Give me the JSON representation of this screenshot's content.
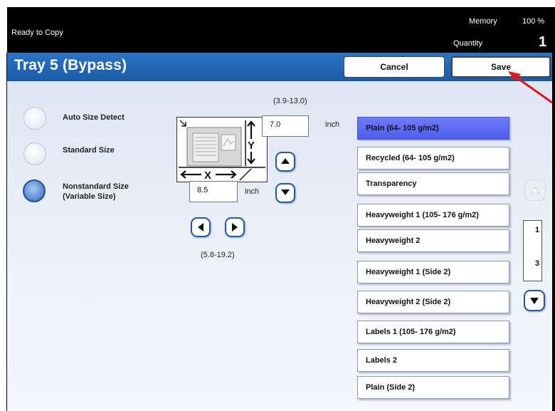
{
  "status": {
    "ready_text": "Ready to Copy",
    "memory_label": "Memory",
    "memory_value": "100 %",
    "quantity_label": "Quantity",
    "quantity_value": "1"
  },
  "header": {
    "title": "Tray 5 (Bypass)",
    "cancel_label": "Cancel",
    "save_label": "Save"
  },
  "size_options": {
    "items": [
      {
        "label": "Auto Size Detect",
        "selected": false
      },
      {
        "label": "Standard Size",
        "selected": false
      },
      {
        "label_line1": "Nonstandard Size",
        "label_line2": "(Variable Size)",
        "selected": true
      }
    ]
  },
  "dimensions": {
    "y_range": "(3.9-13.0)",
    "y_value": "7.0",
    "y_unit": "inch",
    "x_range": "(5.8-19.2)",
    "x_value": "8.5",
    "x_unit": "inch",
    "x_axis_letter": "X",
    "y_axis_letter": "Y"
  },
  "media_types": {
    "items": [
      {
        "label": "Plain (64- 105 g/m2)",
        "selected": true
      },
      {
        "label": "Recycled (64- 105 g/m2)",
        "selected": false
      },
      {
        "label": "Transparency",
        "selected": false
      },
      {
        "label": "Heavyweight 1 (105- 176 g/m2)",
        "selected": false
      },
      {
        "label": "Heavyweight 2",
        "selected": false
      },
      {
        "label": "Heavyweight 1 (Side 2)",
        "selected": false
      },
      {
        "label": "Heavyweight 2 (Side 2)",
        "selected": false
      },
      {
        "label": "Labels 1 (105- 176 g/m2)",
        "selected": false
      },
      {
        "label": "Labels 2",
        "selected": false
      },
      {
        "label": "Plain (Side 2)",
        "selected": false
      }
    ]
  },
  "pager": {
    "current_page": "1",
    "total_pages": "3"
  },
  "colors": {
    "title_bar": "#1a5ba6",
    "selected_item": "#5b6bf3",
    "annotation_arrow": "#e0141a"
  }
}
